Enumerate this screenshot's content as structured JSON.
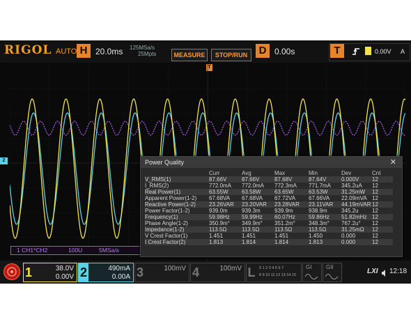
{
  "brand": "RIGOL",
  "mode": "AUTO",
  "horizontal": {
    "badge": "H",
    "timebase": "20.0ms",
    "sample_rate": "125MSa/s",
    "mem_depth": "25Mpts"
  },
  "buttons": {
    "measure": "MEASURE",
    "run_stop": "STOP/RUN"
  },
  "delay": {
    "badge": "D",
    "value": "0.00s"
  },
  "trigger": {
    "badge": "T",
    "level": "0.00V",
    "source": "A"
  },
  "trigger_marker": "T",
  "channel_marker": "2",
  "math_label": {
    "expr": "1 CH1*CH2",
    "scale": "100U",
    "rate": "5MSa/s"
  },
  "power_quality": {
    "title": "Power Quality",
    "close": "✕",
    "headers": [
      "",
      "Curr",
      "Avg",
      "Max",
      "Min",
      "Dev",
      "Cnt"
    ],
    "rows": [
      [
        "V_RMS(1)",
        "87.66V",
        "87.66V",
        "87.68V",
        "87.64V",
        "0.000V",
        "12"
      ],
      [
        "I_RMS(2)",
        "772.0mA",
        "772.0mA",
        "772.3mA",
        "771.7mA",
        "345.2uA",
        "12"
      ],
      [
        "Real Power(1)",
        "63.55W",
        "63.58W",
        "63.65W",
        "63.53W",
        "31.25mW",
        "12"
      ],
      [
        "Apparent Power(1-2)",
        "67.68VA",
        "67.68VA",
        "67.72VA",
        "67.66VA",
        "22.09mVA",
        "12"
      ],
      [
        "Reactive Power(1-2)",
        "23.26VAR",
        "23.20VAR",
        "23.28VAR",
        "23.11VAR",
        "44.19mVAR",
        "12"
      ],
      [
        "Power Factor(1-2)",
        "939.0m",
        "939.3m",
        "939.9m",
        "938.9m",
        "345.2u",
        "12"
      ],
      [
        "Frequency(1)",
        "59.98Hz",
        "59.99Hz",
        "60.07Hz",
        "59.86Hz",
        "51.82mHz",
        "12"
      ],
      [
        "Phase Angle(1-2)",
        "350.9m°",
        "349.9m°",
        "351.2m°",
        "348.3m°",
        "767.2u°",
        "12"
      ],
      [
        "Impedance(1-2)",
        "113.5Ω",
        "113.5Ω",
        "113.5Ω",
        "113.5Ω",
        "31.25mΩ",
        "12"
      ],
      [
        "V Crest Factor(1)",
        "1.451",
        "1.451",
        "1.451",
        "1.450",
        "0.000",
        "12"
      ],
      [
        "I Crest Factor(2)",
        "1.813",
        "1.814",
        "1.814",
        "1.813",
        "0.000",
        "12"
      ]
    ]
  },
  "channels": [
    {
      "num": "1",
      "scale": "38.0V",
      "offset": "0.00V",
      "color": "#f2e34a"
    },
    {
      "num": "2",
      "scale": "490mA",
      "offset": "0.00A",
      "color": "#5ad2e6"
    },
    {
      "num": "3",
      "scale": "100mV",
      "offset": "",
      "color": "#888888"
    },
    {
      "num": "4",
      "scale": "100mV",
      "offset": "",
      "color": "#888888"
    }
  ],
  "logic": {
    "badge": "L",
    "row1": "0 1 2 3  4 5 6 7",
    "row2": "8 9 10 11 12 13 14 15"
  },
  "generators": [
    "GI",
    "GII"
  ],
  "status": {
    "lxi": "LXI",
    "time": "12:18"
  },
  "colors": {
    "ch1": "#f2e34a",
    "ch2": "#5ad2e6",
    "math": "#9b57d6",
    "accent": "#e9832a"
  }
}
